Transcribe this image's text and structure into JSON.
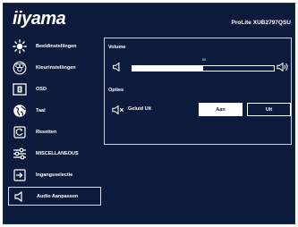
{
  "header": {
    "brand": "iiyama",
    "model": "ProLite XUB2797QSU"
  },
  "sidebar": {
    "items": [
      {
        "label": "Beeldinstellingen",
        "icon": "brightness-icon"
      },
      {
        "label": "Kleurinstellingen",
        "icon": "color-palette-icon"
      },
      {
        "label": "OSD",
        "icon": "osd-icon"
      },
      {
        "label": "Taal",
        "icon": "globe-icon"
      },
      {
        "label": "Resetten",
        "icon": "reset-icon"
      },
      {
        "label": "MISCELLANEOUS",
        "icon": "sliders-icon"
      },
      {
        "label": "Ingangsselectie",
        "icon": "input-icon"
      },
      {
        "label": "Audio Aanpassen",
        "icon": "speaker-icon",
        "active": true
      }
    ]
  },
  "panel": {
    "volume_label": "Volume",
    "volume_value": "50",
    "volume_level": 0.5,
    "options_label": "Opties",
    "mute_label": "Geluid Uit",
    "on_label": "Aan",
    "off_label": "Uit",
    "selected": "Aan"
  },
  "colors": {
    "background": "#0c1a3c",
    "text": "#ffffff",
    "border": "#c7cedc"
  }
}
